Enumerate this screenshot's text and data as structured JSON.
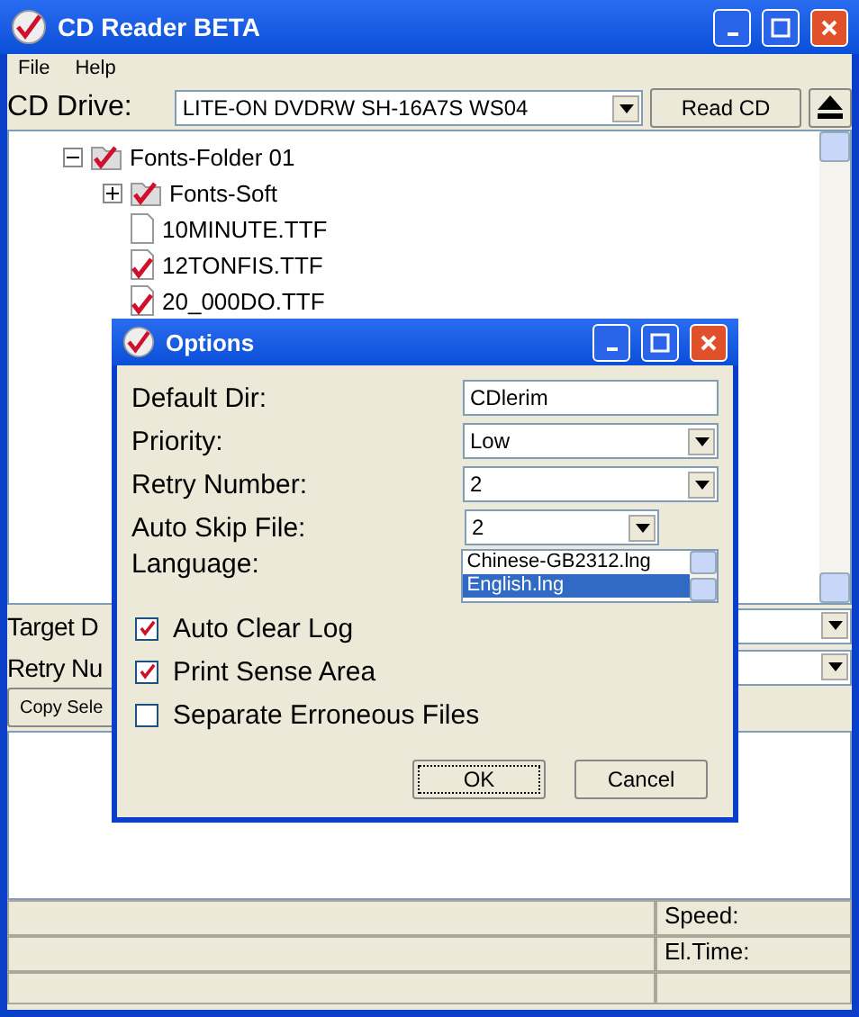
{
  "window": {
    "title": "CD Reader BETA"
  },
  "menu": [
    "File",
    "Help"
  ],
  "drive": {
    "label": "CD Drive:",
    "value": "LITE-ON DVDRW SH-16A7S  WS04",
    "read_button": "Read CD"
  },
  "tree": [
    {
      "label": "Fonts-Folder 01",
      "kind": "folder",
      "checked": true,
      "expanded": true,
      "children": [
        {
          "label": "Fonts-Soft",
          "kind": "folder",
          "checked": true,
          "expanded": false
        },
        {
          "label": "10MINUTE.TTF",
          "kind": "file",
          "checked": false
        },
        {
          "label": "12TONFIS.TTF",
          "kind": "file",
          "checked": true
        },
        {
          "label": "20_000DO.TTF",
          "kind": "file",
          "checked": true
        }
      ]
    }
  ],
  "settings": [
    {
      "label": "Target D"
    },
    {
      "label": "Retry Nu"
    }
  ],
  "copy_button": "Copy Sele",
  "status": {
    "speed": "Speed:",
    "time": "El.Time:"
  },
  "dialog": {
    "title": "Options",
    "fields": [
      {
        "label": "Default Dir:",
        "kind": "text",
        "value": "CDlerim"
      },
      {
        "label": "Priority:",
        "kind": "select",
        "value": "Low"
      },
      {
        "label": "Retry Number:",
        "kind": "select",
        "value": "2"
      },
      {
        "label": "Auto Skip File:",
        "kind": "short-select",
        "value": "2"
      },
      {
        "label": "Language:",
        "kind": "list",
        "options": [
          {
            "label": "Chinese-GB2312.lng",
            "selected": false
          },
          {
            "label": "English.lng",
            "selected": true
          }
        ]
      }
    ],
    "checks": [
      {
        "label": "Auto Clear Log",
        "checked": true
      },
      {
        "label": "Print Sense Area",
        "checked": true
      },
      {
        "label": "Separate Erroneous Files",
        "checked": false
      }
    ],
    "buttons": [
      "OK",
      "Cancel"
    ]
  }
}
